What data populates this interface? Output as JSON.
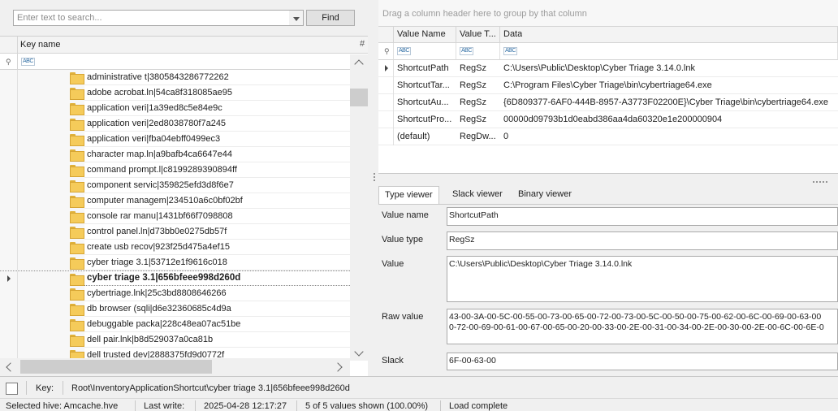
{
  "search": {
    "placeholder": "Enter text to search...",
    "find_label": "Find"
  },
  "keys_grid": {
    "header": "Key name",
    "hash_header": "#",
    "filter_icon": "pin-icon",
    "filter_glyph": "ABC",
    "rows": [
      "administrative t|3805843286772262",
      "adobe acrobat.ln|54ca8f318085ae95",
      "application veri|1a39ed8c5e84e9c",
      "application veri|2ed8038780f7a245",
      "application veri|fba04ebff0499ec3",
      "character map.ln|a9bafb4ca6647e44",
      "command prompt.l|c8199289390894ff",
      "component servic|359825efd3d8f6e7",
      "computer managem|234510a6c0bf02bf",
      "console rar manu|1431bf66f7098808",
      "control panel.ln|d73bb0e0275db57f",
      "create usb recov|923f25d475a4ef15",
      "cyber triage 3.1|53712e1f9616c018",
      "cyber triage 3.1|656bfeee998d260d",
      "cybertriage.lnk|25c3bd8808646266",
      "db browser (sqli|d6e32360685c4d9a",
      "debuggable packa|228c48ea07ac51be",
      "dell pair.lnk|b8d529037a0ca81b",
      "dell trusted dev|2888375fd9d0772f"
    ],
    "selected_index": 13
  },
  "values_grid": {
    "group_hint": "Drag a column header here to group by that column",
    "columns": [
      "Value Name",
      "Value T...",
      "Data"
    ],
    "rows": [
      {
        "name": "ShortcutPath",
        "type": "RegSz",
        "data": "C:\\Users\\Public\\Desktop\\Cyber Triage 3.14.0.lnk"
      },
      {
        "name": "ShortcutTar...",
        "type": "RegSz",
        "data": "C:\\Program Files\\Cyber Triage\\bin\\cybertriage64.exe"
      },
      {
        "name": "ShortcutAu...",
        "type": "RegSz",
        "data": "{6D809377-6AF0-444B-8957-A3773F02200E}\\Cyber Triage\\bin\\cybertriage64.exe"
      },
      {
        "name": "ShortcutPro...",
        "type": "RegSz",
        "data": "00000d09793b1d0eabd386aa4da60320e1e200000904"
      },
      {
        "name": "(default)",
        "type": "RegDw...",
        "data": "0"
      }
    ]
  },
  "details": {
    "tabs": [
      "Type viewer",
      "Slack viewer",
      "Binary viewer"
    ],
    "labels": {
      "name": "Value name",
      "type": "Value type",
      "value": "Value",
      "raw": "Raw value",
      "slack": "Slack"
    },
    "value_name": "ShortcutPath",
    "value_type": "RegSz",
    "value": "C:\\Users\\Public\\Desktop\\Cyber Triage 3.14.0.lnk",
    "raw_line1": "43-00-3A-00-5C-00-55-00-73-00-65-00-72-00-73-00-5C-00-50-00-75-00-62-00-6C-00-69-00-63-00",
    "raw_line2": "0-72-00-69-00-61-00-67-00-65-00-20-00-33-00-2E-00-31-00-34-00-2E-00-30-00-2E-00-6C-00-6E-0",
    "slack": "6F-00-63-00"
  },
  "keybar": {
    "label": "Key:",
    "path": "Root\\InventoryApplicationShortcut\\cyber triage 3.1|656bfeee998d260d"
  },
  "status": {
    "hive": "Selected hive: Amcache.hve",
    "last_write_label": "Last write:",
    "last_write": "2025-04-28 12:17:27",
    "shown": "5 of 5 values shown (100.00%)",
    "state": "Load complete"
  }
}
